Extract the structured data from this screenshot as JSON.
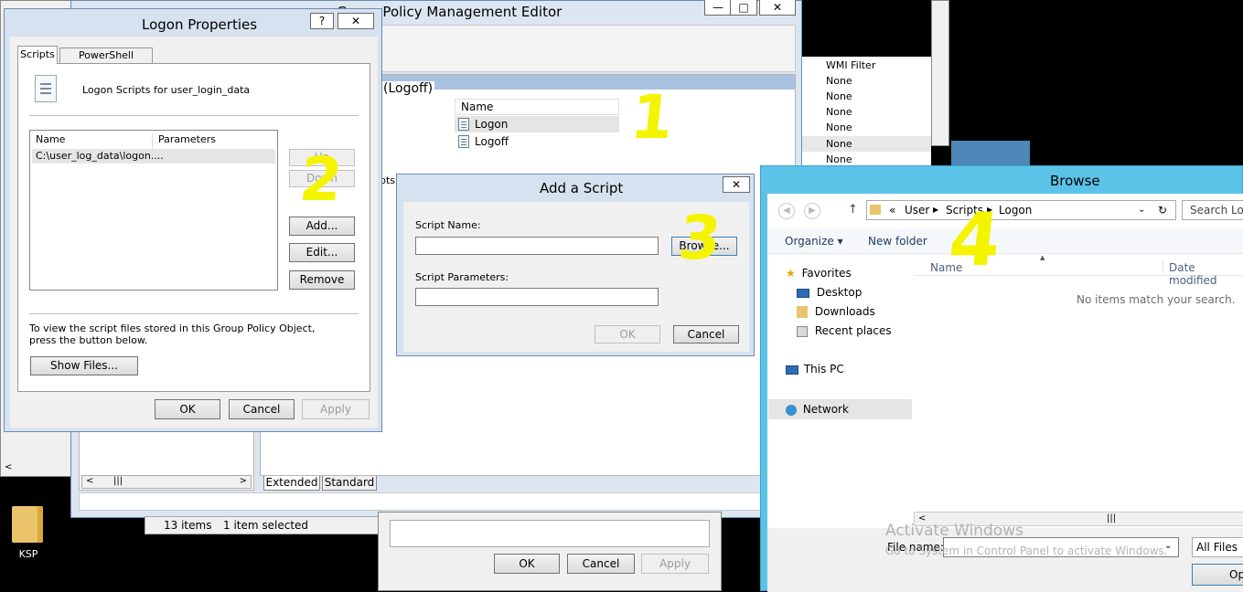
{
  "desktop": {
    "icon_label": "KSP"
  },
  "gpme": {
    "title": "Group Policy Management Editor",
    "section_header": "(Logoff)",
    "name_col": "Name",
    "items": [
      "Logon",
      "Logoff"
    ],
    "partial_text": "pts.",
    "tabs": [
      "Extended",
      "Standard"
    ],
    "minimize": "—",
    "maximize": "□",
    "close": "✕"
  },
  "background_explorer": {
    "wmi_header": "WMI Filter",
    "wmi_values": [
      "None",
      "None",
      "None",
      "None",
      "None",
      "None"
    ],
    "status_items": "13 items",
    "status_selected": "1 item selected"
  },
  "bottom_dialog": {
    "ok": "OK",
    "cancel": "Cancel",
    "apply": "Apply"
  },
  "logon_props": {
    "title": "Logon Properties",
    "help": "?",
    "close": "✕",
    "tabs": [
      "Scripts",
      "PowerShell Scripts"
    ],
    "header_text": "Logon Scripts for user_login_data",
    "col_name": "Name",
    "col_params": "Parameters",
    "row1": "C:\\user_log_data\\logon....",
    "up": "Up",
    "down": "Down",
    "add": "Add...",
    "edit": "Edit...",
    "remove": "Remove",
    "info": "To view the script files stored in this Group Policy Object, press the button below.",
    "show_files": "Show Files...",
    "ok": "OK",
    "cancel": "Cancel",
    "apply": "Apply"
  },
  "add_script": {
    "title": "Add a Script",
    "close": "✕",
    "name_label": "Script Name:",
    "params_label": "Script Parameters:",
    "name_value": "",
    "params_value": "",
    "browse": "Browse...",
    "ok": "OK",
    "cancel": "Cancel"
  },
  "browse": {
    "title": "Browse",
    "breadcrumb": [
      "«",
      "User",
      "Scripts",
      "Logon"
    ],
    "search_placeholder": "Search Log",
    "organize": "Organize ▾",
    "new_folder": "New folder",
    "nav": {
      "favorites": "Favorites",
      "desktop": "Desktop",
      "downloads": "Downloads",
      "recent": "Recent places",
      "this_pc": "This PC",
      "network": "Network"
    },
    "col_name": "Name",
    "col_date": "Date modified",
    "empty_msg": "No items match your search.",
    "filename_label": "File name:",
    "filename_value": "",
    "filter": "All Files",
    "open": "Open"
  },
  "watermark": {
    "line1": "Activate Windows",
    "line2": "Go to System in Control Panel to activate Windows."
  },
  "annotations": [
    "1",
    "2",
    "3",
    "4"
  ],
  "colors": {
    "accent_title": "#5bc3e8",
    "highlight": "#f4f400",
    "section_blue": "#a9c2e0"
  }
}
